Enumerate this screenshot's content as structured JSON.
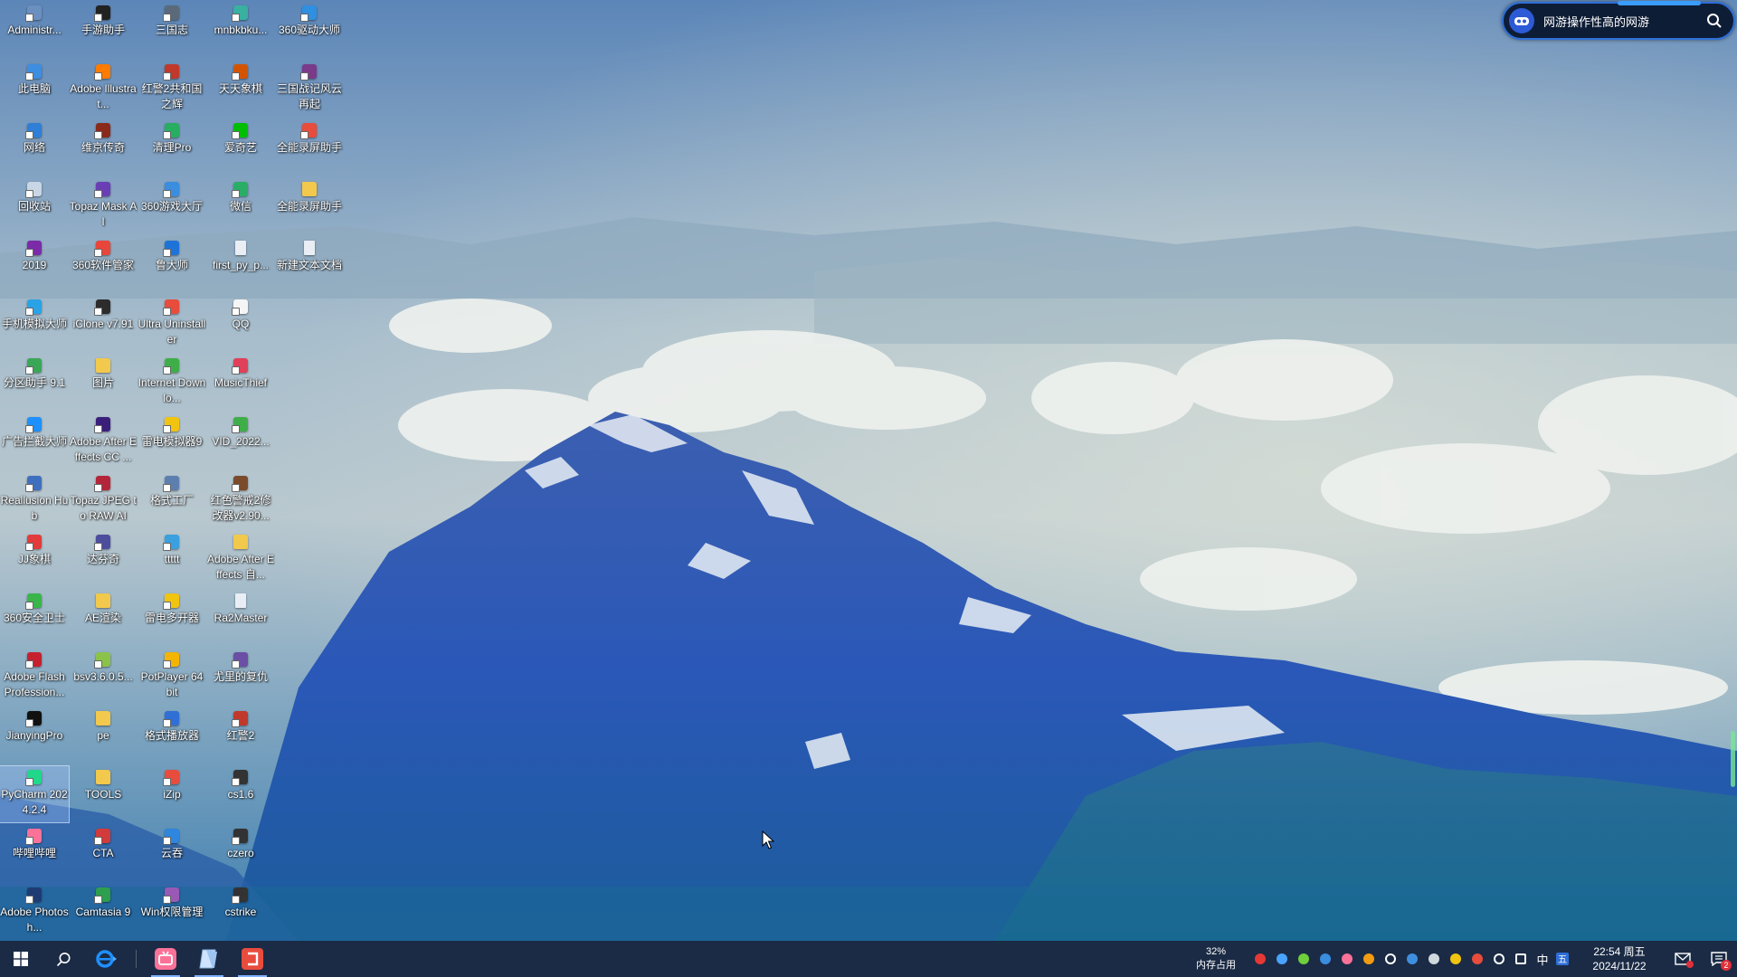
{
  "desktop": {
    "icons": [
      {
        "label": "Administr...",
        "color": "#6b8fbf",
        "kind": "app"
      },
      {
        "label": "此电脑",
        "color": "#3d8de0",
        "kind": "app"
      },
      {
        "label": "网络",
        "color": "#2f7fd6",
        "kind": "app"
      },
      {
        "label": "回收站",
        "color": "#c9d6e6",
        "kind": "app"
      },
      {
        "label": "2019",
        "color": "#7b2aa8",
        "kind": "app"
      },
      {
        "label": "手机模拟大师",
        "color": "#2aa3e6",
        "kind": "app"
      },
      {
        "label": "分区助手 9.1",
        "color": "#3aa757",
        "kind": "app"
      },
      {
        "label": "广告拦截大师",
        "color": "#1e90ff",
        "kind": "app"
      },
      {
        "label": "Reallusion Hub",
        "color": "#3f6fbf",
        "kind": "app"
      },
      {
        "label": "JJ象棋",
        "color": "#e23b3b",
        "kind": "app"
      },
      {
        "label": "360安全卫士",
        "color": "#39b54a",
        "kind": "app"
      },
      {
        "label": "Adobe Flash Profession...",
        "color": "#c6202f",
        "kind": "app"
      },
      {
        "label": "JianyingPro",
        "color": "#111111",
        "kind": "app"
      },
      {
        "label": "PyCharm 2024.2.4",
        "color": "#21d789",
        "kind": "app",
        "selected": true
      },
      {
        "label": "哔哩哔哩",
        "color": "#fb7299",
        "kind": "app"
      },
      {
        "label": "Adobe Photosh...",
        "color": "#1f3b73",
        "kind": "app"
      },
      {
        "label": "手游助手",
        "color": "#222222",
        "kind": "app"
      },
      {
        "label": "Adobe Illustrat...",
        "color": "#ff7c00",
        "kind": "app"
      },
      {
        "label": "维京传奇",
        "color": "#8a2a1a",
        "kind": "app"
      },
      {
        "label": "Topaz Mask AI",
        "color": "#6a3fb5",
        "kind": "app"
      },
      {
        "label": "360软件管家",
        "color": "#e8463b",
        "kind": "app"
      },
      {
        "label": "iClone v7.91",
        "color": "#2c2c2c",
        "kind": "app"
      },
      {
        "label": "图片",
        "color": "#f2c94c",
        "kind": "folder"
      },
      {
        "label": "Adobe After Effects CC ...",
        "color": "#3a1f7a",
        "kind": "app"
      },
      {
        "label": "Topaz JPEG to RAW AI",
        "color": "#b3263a",
        "kind": "app"
      },
      {
        "label": "达芬奇",
        "color": "#4d4d9e",
        "kind": "app"
      },
      {
        "label": "AE渲染",
        "color": "#f2c94c",
        "kind": "folder"
      },
      {
        "label": "bsv3.6.0.5...",
        "color": "#8bc34a",
        "kind": "app"
      },
      {
        "label": "pe",
        "color": "#f2c94c",
        "kind": "folder"
      },
      {
        "label": "TOOLS",
        "color": "#f2c94c",
        "kind": "folder"
      },
      {
        "label": "CTA",
        "color": "#d13b3b",
        "kind": "app"
      },
      {
        "label": "Camtasia 9",
        "color": "#2e9e4f",
        "kind": "app"
      },
      {
        "label": "三国志",
        "color": "#5a6a7a",
        "kind": "app"
      },
      {
        "label": "红警2共和国之辉",
        "color": "#c0392b",
        "kind": "app"
      },
      {
        "label": "清理Pro",
        "color": "#27ae60",
        "kind": "app"
      },
      {
        "label": "360游戏大厅",
        "color": "#3b8de0",
        "kind": "app"
      },
      {
        "label": "鲁大师",
        "color": "#1e73d8",
        "kind": "app"
      },
      {
        "label": "Ultra Uninstaller",
        "color": "#e74c3c",
        "kind": "app"
      },
      {
        "label": "Internet Downlo...",
        "color": "#3fae49",
        "kind": "app"
      },
      {
        "label": "雷电模拟器9",
        "color": "#f1c40f",
        "kind": "app"
      },
      {
        "label": "格式工厂",
        "color": "#5d7fb0",
        "kind": "app"
      },
      {
        "label": "ttttt",
        "color": "#3aa0e0",
        "kind": "app"
      },
      {
        "label": "雷电多开器",
        "color": "#f1c40f",
        "kind": "app"
      },
      {
        "label": "PotPlayer 64 bit",
        "color": "#f5b400",
        "kind": "app"
      },
      {
        "label": "格式播放器",
        "color": "#2f6fd6",
        "kind": "app"
      },
      {
        "label": "iZip",
        "color": "#e84c3d",
        "kind": "app"
      },
      {
        "label": "云吞",
        "color": "#2e86de",
        "kind": "app"
      },
      {
        "label": "Win权限管理",
        "color": "#9b59b6",
        "kind": "app"
      },
      {
        "label": "mnbkbku...",
        "color": "#3ab0a0",
        "kind": "app"
      },
      {
        "label": "天天象棋",
        "color": "#d35400",
        "kind": "app"
      },
      {
        "label": "爱奇艺",
        "color": "#00be06",
        "kind": "app"
      },
      {
        "label": "微信",
        "color": "#2aae67",
        "kind": "app"
      },
      {
        "label": "first_py_p...",
        "color": "#e9eef5",
        "kind": "file"
      },
      {
        "label": "QQ",
        "color": "#f5f5f5",
        "kind": "app"
      },
      {
        "label": "MusicThief",
        "color": "#e0405a",
        "kind": "app"
      },
      {
        "label": "VID_2022...",
        "color": "#3fae49",
        "kind": "app"
      },
      {
        "label": "红色警戒2修改器v2.90...",
        "color": "#7a4b2a",
        "kind": "app"
      },
      {
        "label": "Adobe After Effects 自...",
        "color": "#f2c94c",
        "kind": "folder"
      },
      {
        "label": "Ra2Master",
        "color": "#e9eef5",
        "kind": "file"
      },
      {
        "label": "尤里的复仇",
        "color": "#6a4fa5",
        "kind": "app"
      },
      {
        "label": "红警2",
        "color": "#c0392b",
        "kind": "app"
      },
      {
        "label": "cs1.6",
        "color": "#333333",
        "kind": "app"
      },
      {
        "label": "czero",
        "color": "#333333",
        "kind": "app"
      },
      {
        "label": "cstrike",
        "color": "#333333",
        "kind": "app"
      },
      {
        "label": "360驱动大师",
        "color": "#2f8fe0",
        "kind": "app"
      },
      {
        "label": "三国战记风云再起",
        "color": "#7a3b8a",
        "kind": "app"
      },
      {
        "label": "全能录屏助手",
        "color": "#e74c3c",
        "kind": "app"
      },
      {
        "label": "全能录屏助手",
        "color": "#f2c94c",
        "kind": "folder"
      },
      {
        "label": "新建文本文档",
        "color": "#e9eef5",
        "kind": "file"
      }
    ]
  },
  "widget": {
    "text": "网游操作性高的网游",
    "icons": {
      "logo": "game-controller-icon",
      "search": "search-icon"
    }
  },
  "taskbar": {
    "memory_percent": "32%",
    "memory_label": "内存占用",
    "ime_label": "中",
    "time": "22:54 周五",
    "date": "2024/11/22",
    "notification_badge": "2",
    "pinned_apps": [
      {
        "name": "ie-browser-icon",
        "color": "#1e73d8"
      },
      {
        "name": "bilibili-app-icon",
        "color": "#fb7299"
      },
      {
        "name": "notepad-app-icon",
        "color": "#cfe3ff"
      },
      {
        "name": "jianying-app-icon",
        "color": "#e84c3d"
      }
    ],
    "tray_icons": [
      {
        "name": "antivirus-icon",
        "color": "#e53935"
      },
      {
        "name": "qq-tray-icon",
        "color": "#4aa3ff"
      },
      {
        "name": "360-tray-icon",
        "color": "#6fcf3c"
      },
      {
        "name": "browser-tray-icon",
        "color": "#3b8de0"
      },
      {
        "name": "bilibili-tray-icon",
        "color": "#fb7299"
      },
      {
        "name": "app-tray-icon",
        "color": "#f39c12"
      },
      {
        "name": "mic-icon",
        "color": "#ffffff"
      },
      {
        "name": "windows-security-icon",
        "color": "#3f8fe0"
      },
      {
        "name": "shield-icon",
        "color": "#cfd8dc"
      },
      {
        "name": "cloud-tray-icon",
        "color": "#f1c40f"
      },
      {
        "name": "arrow-tray-icon",
        "color": "#e74c3c"
      },
      {
        "name": "volume-icon",
        "color": "#ffffff"
      },
      {
        "name": "network-icon",
        "color": "#ffffff"
      }
    ]
  },
  "colors": {
    "taskbar_bg": "#1b2b45",
    "widget_border": "#2f6fd8",
    "selected_icon": "#aac8ff"
  }
}
